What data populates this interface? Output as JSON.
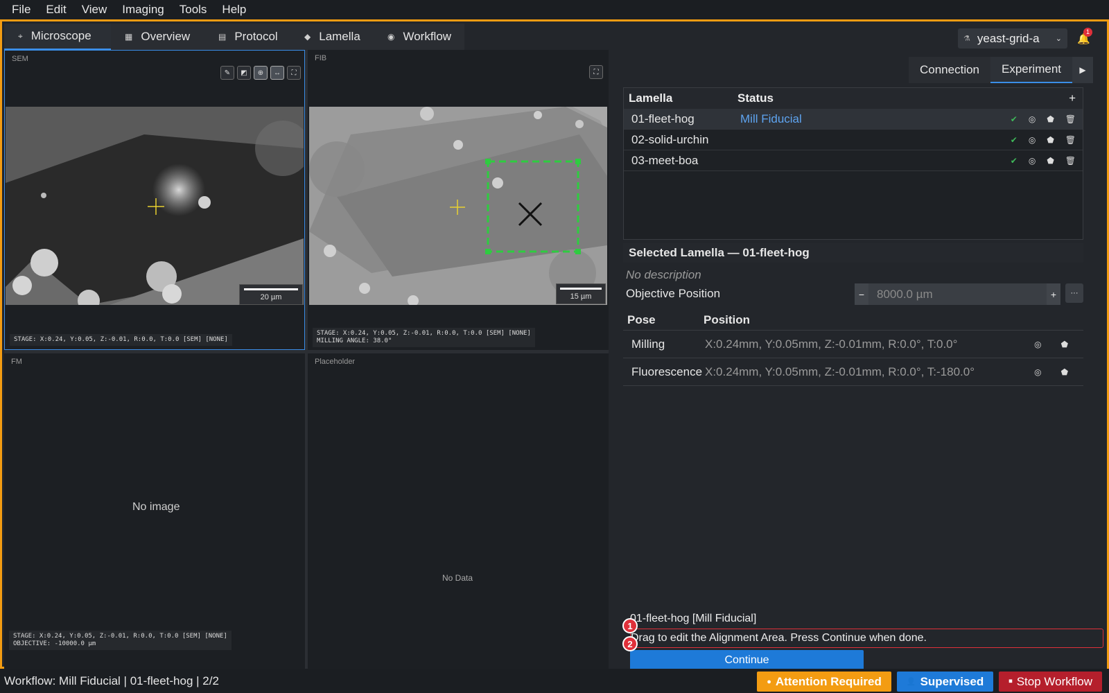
{
  "menu": [
    "File",
    "Edit",
    "View",
    "Imaging",
    "Tools",
    "Help"
  ],
  "tabs": [
    {
      "label": "Microscope",
      "icon": "microscope-icon"
    },
    {
      "label": "Overview",
      "icon": "map-icon"
    },
    {
      "label": "Protocol",
      "icon": "document-icon"
    },
    {
      "label": "Lamella",
      "icon": "layers-icon"
    },
    {
      "label": "Workflow",
      "icon": "play-circle-icon"
    }
  ],
  "project": {
    "name": "yeast-grid-a",
    "notification_count": "1"
  },
  "sem": {
    "label": "SEM",
    "scale": "20 µm",
    "stage": "STAGE: X:0.24, Y:0.05, Z:-0.01, R:0.0, T:0.0 [SEM] [NONE]"
  },
  "fib": {
    "label": "FIB",
    "scale": "15 µm",
    "stage_line1": "STAGE: X:0.24, Y:0.05, Z:-0.01, R:0.0, T:0.0 [SEM] [NONE]",
    "stage_line2": "MILLING ANGLE: 38.0°"
  },
  "fm": {
    "label": "FM",
    "message": "No image",
    "stage_line1": "STAGE: X:0.24, Y:0.05, Z:-0.01, R:0.0, T:0.0 [SEM] [NONE]",
    "stage_line2": "OBJECTIVE: -10000.0 µm"
  },
  "placeholder": {
    "label": "Placeholder",
    "message": "No Data"
  },
  "right_tabs": [
    "Connection",
    "Experiment"
  ],
  "lamella_table": {
    "headers": [
      "Lamella",
      "Status"
    ],
    "rows": [
      {
        "name": "01-fleet-hog",
        "status": "Mill Fiducial"
      },
      {
        "name": "02-solid-urchin",
        "status": ""
      },
      {
        "name": "03-meet-boa",
        "status": ""
      }
    ]
  },
  "selected": {
    "title": "Selected Lamella — 01-fleet-hog",
    "description": "No description",
    "objective_label": "Objective Position",
    "objective_value": "8000.0 µm",
    "pose_headers": [
      "Pose",
      "Position"
    ],
    "poses": [
      {
        "name": "Milling",
        "position": "X:0.24mm, Y:0.05mm, Z:-0.01mm, R:0.0°, T:0.0°"
      },
      {
        "name": "Fluorescence",
        "position": "X:0.24mm, Y:0.05mm, Z:-0.01mm, R:0.0°, T:-180.0°"
      }
    ]
  },
  "workflow": {
    "title": "01-fleet-hog [Mill Fiducial]",
    "instruction": "Drag to edit the Alignment Area. Press Continue when done.",
    "continue_label": "Continue",
    "markers": [
      "1",
      "2"
    ]
  },
  "status": {
    "text": "Workflow: Mill Fiducial | 01-fleet-hog | 2/2",
    "attention": "Attention Required",
    "supervised": "Supervised",
    "stop": "Stop Workflow"
  },
  "colors": {
    "accent": "#f39c12",
    "primary": "#1e7ad8",
    "danger": "#b51f2c",
    "ok": "#3fb95a",
    "roi": "#2ecc40"
  }
}
